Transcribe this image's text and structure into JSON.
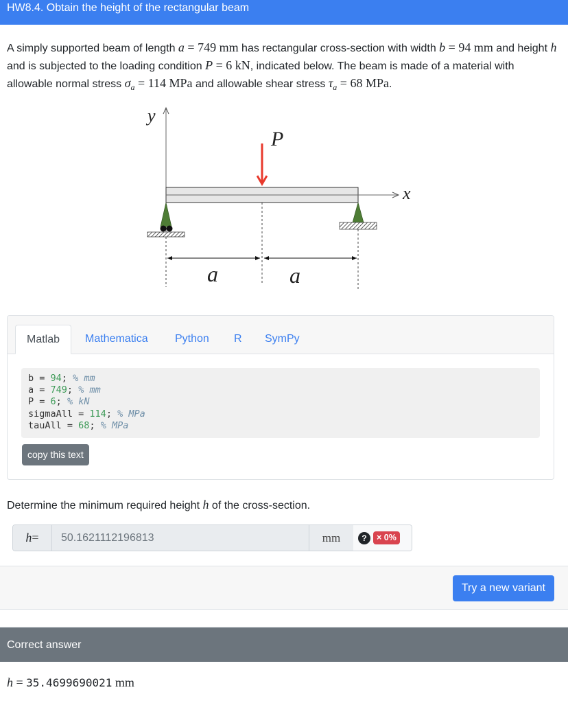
{
  "header": {
    "title": "HW8.4. Obtain the height of the rectangular beam"
  },
  "intro": {
    "t1": "A simply supported beam of length ",
    "a_sym": "a",
    "a_eq": " = 749 ",
    "a_unit": "mm",
    "t2": " has rectangular cross-section with width ",
    "b_sym": "b",
    "b_eq": " = 94 ",
    "b_unit": "mm",
    "t3": " and height ",
    "h_sym": "h",
    "t4": " and is subjected to the loading condition ",
    "P_sym": "P",
    "P_eq": " = 6 kN",
    "t5": ", indicated below. The beam is made of a material with allowable normal stress ",
    "sigma_sym": "σ",
    "sigma_sub": "a",
    "sigma_eq": " = 114 MPa",
    "t6": " and allowable shear stress ",
    "tau_sym": "τ",
    "tau_sub": "a",
    "tau_eq": " = 68 MPa",
    "t7": "."
  },
  "figure": {
    "y_label": "y",
    "x_label": "x",
    "load_label": "P",
    "span_left_label": "a",
    "span_right_label": "a",
    "load_color": "#e8392c",
    "support_color": "#4e7d35"
  },
  "code_tabs": {
    "tabs": [
      {
        "label": "Matlab",
        "active": true
      },
      {
        "label": "Mathematica",
        "active": false
      },
      {
        "label": "Python",
        "active": false
      },
      {
        "label": "R",
        "active": false
      },
      {
        "label": "SymPy",
        "active": false
      }
    ],
    "lines": [
      {
        "var": "b",
        "value": "94",
        "comment": "% mm"
      },
      {
        "var": "a",
        "value": "749",
        "comment": "% mm"
      },
      {
        "var": "P",
        "value": "6",
        "comment": "% kN"
      },
      {
        "var": "sigmaAll",
        "value": "114",
        "comment": "% MPa"
      },
      {
        "var": "tauAll",
        "value": "68",
        "comment": "% MPa"
      }
    ],
    "copy_label": "copy this text"
  },
  "question": {
    "t1": "Determine the minimum required height ",
    "h_sym": "h",
    "t2": " of the cross-section."
  },
  "answer": {
    "prefix_sym": "h",
    "prefix_eq": " =",
    "value": "50.1621112196813",
    "unit": "mm",
    "help_icon": "?",
    "score_label": "× 0%",
    "score_color": "#d9444f"
  },
  "footer": {
    "new_variant_label": "Try a new variant"
  },
  "correct": {
    "header": "Correct answer",
    "sym": "h",
    "eq": " = ",
    "value": "35.4699690021",
    "unit": " mm"
  }
}
